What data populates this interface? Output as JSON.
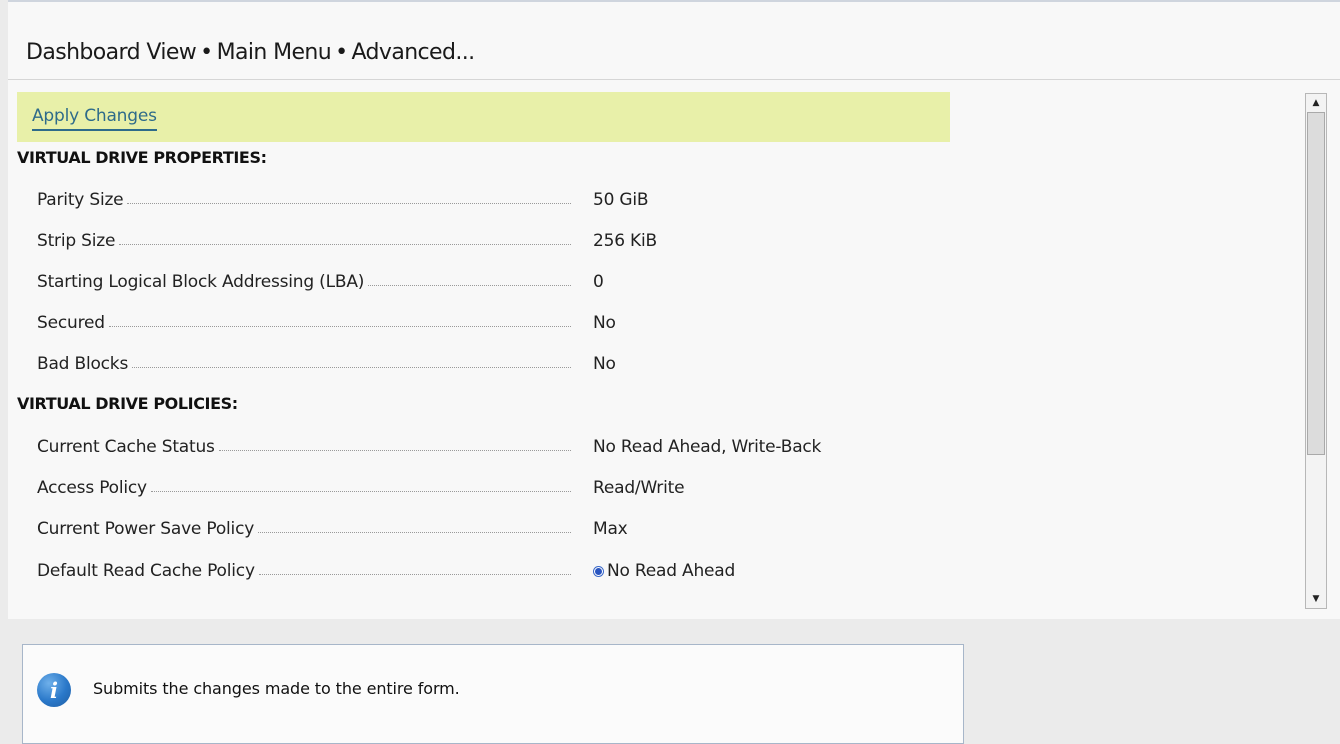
{
  "breadcrumb": [
    "Dashboard View",
    "Main Menu",
    "Advanced..."
  ],
  "breadcrumb_separator": "•",
  "apply_label": "Apply Changes",
  "sections": [
    {
      "header": "VIRTUAL DRIVE PROPERTIES:",
      "rows": [
        {
          "label": "Parity Size",
          "value": "50 GiB"
        },
        {
          "label": "Strip Size",
          "value": "256 KiB"
        },
        {
          "label": "Starting Logical Block Addressing (LBA)",
          "value": "0"
        },
        {
          "label": "Secured",
          "value": "No"
        },
        {
          "label": "Bad Blocks",
          "value": "No"
        }
      ]
    },
    {
      "header": "VIRTUAL DRIVE POLICIES:",
      "rows": [
        {
          "label": "Current Cache Status",
          "value": "No Read Ahead, Write-Back"
        },
        {
          "label": "Access Policy",
          "value": "Read/Write"
        },
        {
          "label": "Current Power Save Policy",
          "value": "Max"
        },
        {
          "label": "Default Read Cache Policy",
          "value": "No Read Ahead",
          "radio_selected": true
        }
      ]
    }
  ],
  "help_text": "Submits the changes made to the entire form.",
  "colors": {
    "apply_bar": "#e8f0a9",
    "link": "#2e6b8a",
    "info_icon": "#2a78c9",
    "radio": "#2a55c0"
  }
}
